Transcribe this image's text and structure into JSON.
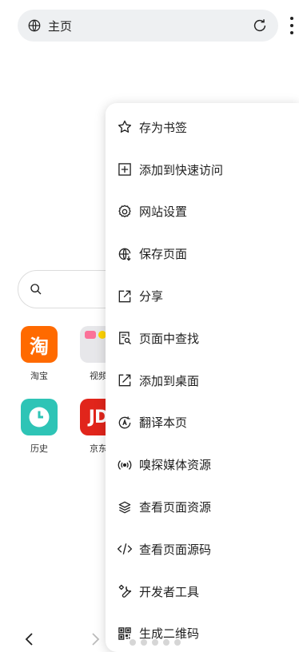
{
  "address_bar": {
    "title": "主页"
  },
  "homepage": {
    "search_placeholder": "",
    "shortcuts": [
      {
        "label": "淘宝",
        "glyph": "淘"
      },
      {
        "label": "视频",
        "glyph": ""
      },
      {
        "label": "历史",
        "glyph": ""
      },
      {
        "label": "京东",
        "glyph": "JD"
      }
    ]
  },
  "menu": {
    "items": [
      {
        "label": "存为书签",
        "icon": "star-icon"
      },
      {
        "label": "添加到快速访问",
        "icon": "plus-square-icon"
      },
      {
        "label": "网站设置",
        "icon": "gear-icon"
      },
      {
        "label": "保存页面",
        "icon": "globe-download-icon"
      },
      {
        "label": "分享",
        "icon": "share-icon"
      },
      {
        "label": "页面中查找",
        "icon": "find-in-page-icon"
      },
      {
        "label": "添加到桌面",
        "icon": "add-to-desktop-icon"
      },
      {
        "label": "翻译本页",
        "icon": "translate-icon"
      },
      {
        "label": "嗅探媒体资源",
        "icon": "sniff-media-icon"
      },
      {
        "label": "查看页面资源",
        "icon": "layers-icon"
      },
      {
        "label": "查看页面源码",
        "icon": "code-icon"
      },
      {
        "label": "开发者工具",
        "icon": "wrench-icon"
      },
      {
        "label": "生成二维码",
        "icon": "qr-code-icon"
      }
    ]
  }
}
